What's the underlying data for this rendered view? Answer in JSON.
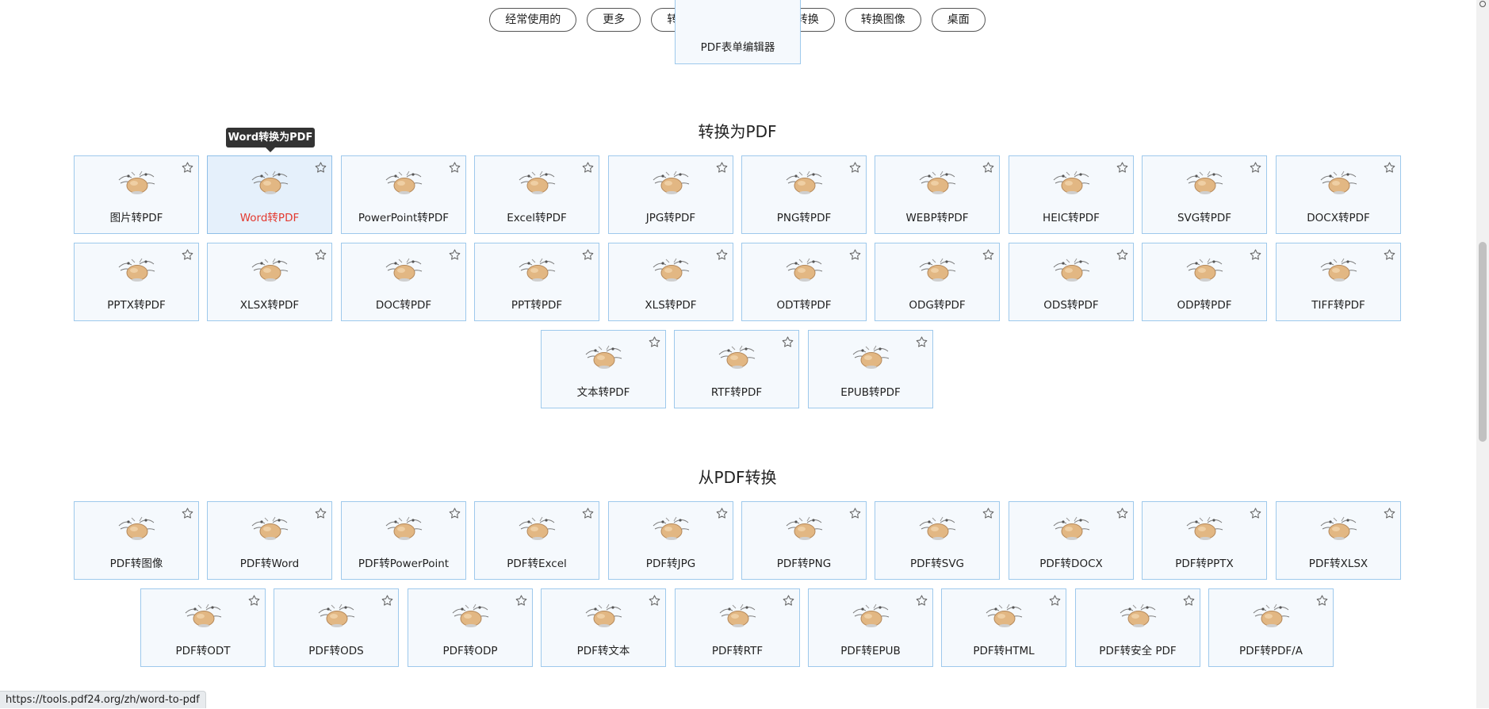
{
  "nav": [
    {
      "label": "经常使用的"
    },
    {
      "label": "更多"
    },
    {
      "label": "转换为PDF"
    },
    {
      "label": "从PDF转换"
    },
    {
      "label": "转换图像"
    },
    {
      "label": "桌面"
    }
  ],
  "partial_tile": {
    "label": "PDF表单编辑器"
  },
  "tooltip": {
    "text": "Word转换为PDF"
  },
  "sections": [
    {
      "title": "转换为PDF",
      "rows": [
        [
          "图片转PDF",
          "Word转PDF",
          "PowerPoint转PDF",
          "Excel转PDF",
          "JPG转PDF",
          "PNG转PDF",
          "WEBP转PDF",
          "HEIC转PDF",
          "SVG转PDF",
          "DOCX转PDF"
        ],
        [
          "PPTX转PDF",
          "XLSX转PDF",
          "DOC转PDF",
          "PPT转PDF",
          "XLS转PDF",
          "ODT转PDF",
          "ODG转PDF",
          "ODS转PDF",
          "ODP转PDF",
          "TIFF转PDF"
        ],
        [
          "文本转PDF",
          "RTF转PDF",
          "EPUB转PDF"
        ]
      ],
      "hovered": "Word转PDF"
    },
    {
      "title": "从PDF转换",
      "rows": [
        [
          "PDF转图像",
          "PDF转Word",
          "PDF转PowerPoint",
          "PDF转Excel",
          "PDF转JPG",
          "PDF转PNG",
          "PDF转SVG",
          "PDF转DOCX",
          "PDF转PPTX",
          "PDF转XLSX"
        ],
        [
          "PDF转ODT",
          "PDF转ODS",
          "PDF转ODP",
          "PDF转文本",
          "PDF转RTF",
          "PDF转EPUB",
          "PDF转HTML",
          "PDF转安全 PDF",
          "PDF转PDF/A"
        ]
      ],
      "hovered": ""
    }
  ],
  "status_bar": {
    "url": "https://tools.pdf24.org/zh/word-to-pdf"
  },
  "icons": {
    "tile": "pdf24-mascot-icon",
    "favorite": "star-outline-icon"
  },
  "colors": {
    "tile_border": "#9ec9ec",
    "tile_bg": "#f5f9fd",
    "hover_label": "#e3392f"
  }
}
